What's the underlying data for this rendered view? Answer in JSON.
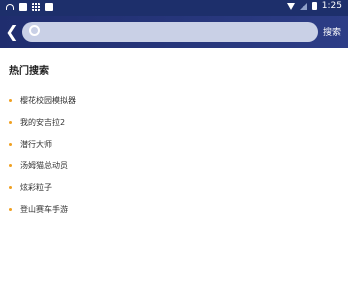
{
  "status_bar": {
    "time": "1:25",
    "icons_left": [
      "wifi-icon",
      "image-icon",
      "grid-icon",
      "app-icon"
    ],
    "icons_right": [
      "wifi-signal-icon",
      "cell-signal-icon",
      "battery-icon"
    ]
  },
  "toolbar": {
    "back_icon": "chevron-left",
    "search_placeholder": "",
    "search_value": "",
    "search_button_label": "搜索"
  },
  "hot_search": {
    "title": "热门搜索",
    "bullet_color": "#f0a020",
    "items": [
      {
        "label": "樱花校园模拟器"
      },
      {
        "label": "我的安吉拉2"
      },
      {
        "label": "潜行大师"
      },
      {
        "label": "汤姆猫总动员"
      },
      {
        "label": "炫彩粒子"
      },
      {
        "label": "登山赛车手游"
      }
    ]
  },
  "colors": {
    "header_bg": "#1f2d6e",
    "search_bg": "#c9d0e6"
  }
}
